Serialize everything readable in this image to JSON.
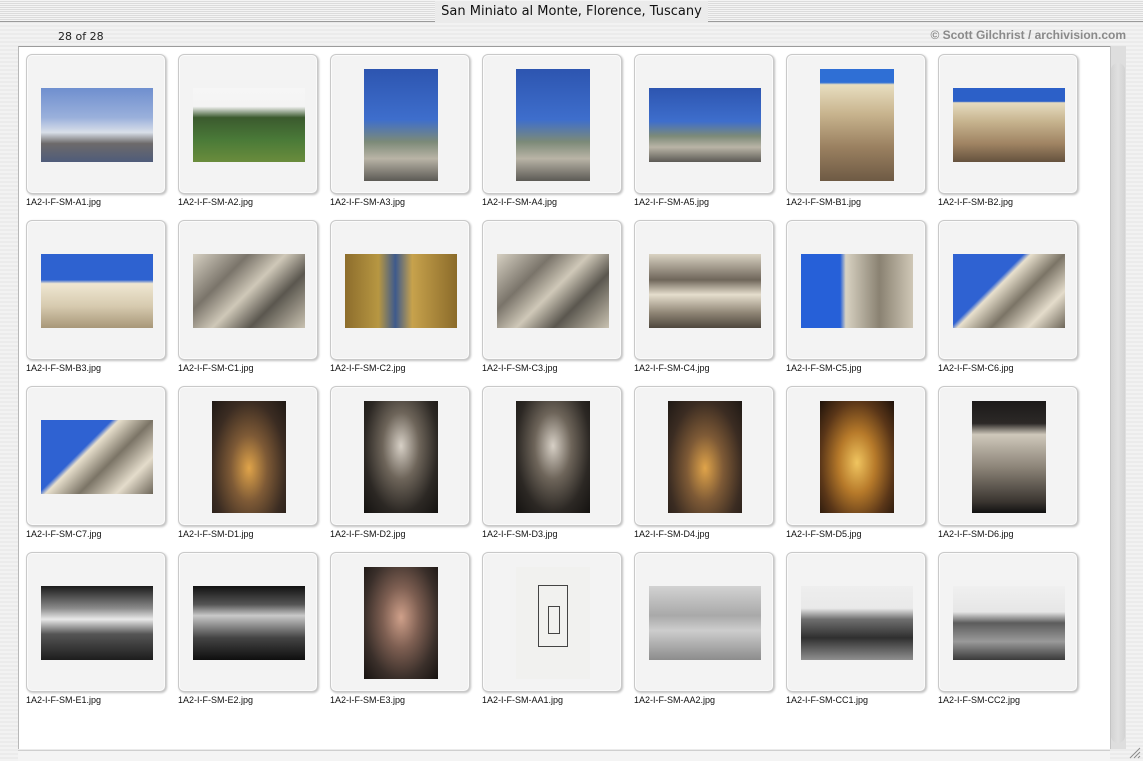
{
  "window": {
    "title": "San Miniato al Monte, Florence, Tuscany",
    "counter": "28 of 28",
    "credit": "© Scott Gilchrist / archivision.com"
  },
  "slides": [
    {
      "file": "1A2-I-F-SM-A1.jpg",
      "orientation": "landscape",
      "tone": "bg-sky"
    },
    {
      "file": "1A2-I-F-SM-A2.jpg",
      "orientation": "landscape",
      "tone": "bg-hill"
    },
    {
      "file": "1A2-I-F-SM-A3.jpg",
      "orientation": "portrait",
      "tone": "bg-blue-photo"
    },
    {
      "file": "1A2-I-F-SM-A4.jpg",
      "orientation": "portrait",
      "tone": "bg-blue-photo"
    },
    {
      "file": "1A2-I-F-SM-A5.jpg",
      "orientation": "landscape",
      "tone": "bg-blue-photo"
    },
    {
      "file": "1A2-I-F-SM-B1.jpg",
      "orientation": "portrait",
      "tone": "bg-facade"
    },
    {
      "file": "1A2-I-F-SM-B2.jpg",
      "orientation": "landscape",
      "tone": "bg-facade-wide"
    },
    {
      "file": "1A2-I-F-SM-B3.jpg",
      "orientation": "landscape",
      "tone": "bg-facade-b3"
    },
    {
      "file": "1A2-I-F-SM-C1.jpg",
      "orientation": "landscape",
      "tone": "bg-marble"
    },
    {
      "file": "1A2-I-F-SM-C2.jpg",
      "orientation": "landscape",
      "tone": "bg-mosaic"
    },
    {
      "file": "1A2-I-F-SM-C3.jpg",
      "orientation": "landscape",
      "tone": "bg-marble"
    },
    {
      "file": "1A2-I-F-SM-C4.jpg",
      "orientation": "landscape",
      "tone": "bg-arch"
    },
    {
      "file": "1A2-I-F-SM-C5.jpg",
      "orientation": "landscape",
      "tone": "bg-blue-side"
    },
    {
      "file": "1A2-I-F-SM-C6.jpg",
      "orientation": "landscape",
      "tone": "bg-roof"
    },
    {
      "file": "1A2-I-F-SM-C7.jpg",
      "orientation": "landscape",
      "tone": "bg-roof"
    },
    {
      "file": "1A2-I-F-SM-D1.jpg",
      "orientation": "portrait",
      "tone": "bg-interior"
    },
    {
      "file": "1A2-I-F-SM-D2.jpg",
      "orientation": "portrait",
      "tone": "bg-interior-dark"
    },
    {
      "file": "1A2-I-F-SM-D3.jpg",
      "orientation": "portrait",
      "tone": "bg-interior-dark"
    },
    {
      "file": "1A2-I-F-SM-D4.jpg",
      "orientation": "portrait",
      "tone": "bg-interior"
    },
    {
      "file": "1A2-I-F-SM-D5.jpg",
      "orientation": "portrait",
      "tone": "bg-gold"
    },
    {
      "file": "1A2-I-F-SM-D6.jpg",
      "orientation": "portrait",
      "tone": "bg-pulpit"
    },
    {
      "file": "1A2-I-F-SM-E1.jpg",
      "orientation": "landscape",
      "tone": "bg-bw"
    },
    {
      "file": "1A2-I-F-SM-E2.jpg",
      "orientation": "landscape",
      "tone": "bg-bw2"
    },
    {
      "file": "1A2-I-F-SM-E3.jpg",
      "orientation": "portrait",
      "tone": "bg-crypt"
    },
    {
      "file": "1A2-I-F-SM-AA1.jpg",
      "orientation": "portrait",
      "tone": "bg-plan"
    },
    {
      "file": "1A2-I-F-SM-AA2.jpg",
      "orientation": "landscape",
      "tone": "bg-engrave"
    },
    {
      "file": "1A2-I-F-SM-CC1.jpg",
      "orientation": "landscape",
      "tone": "bg-oldphoto"
    },
    {
      "file": "1A2-I-F-SM-CC2.jpg",
      "orientation": "landscape",
      "tone": "bg-oldphoto2"
    }
  ]
}
